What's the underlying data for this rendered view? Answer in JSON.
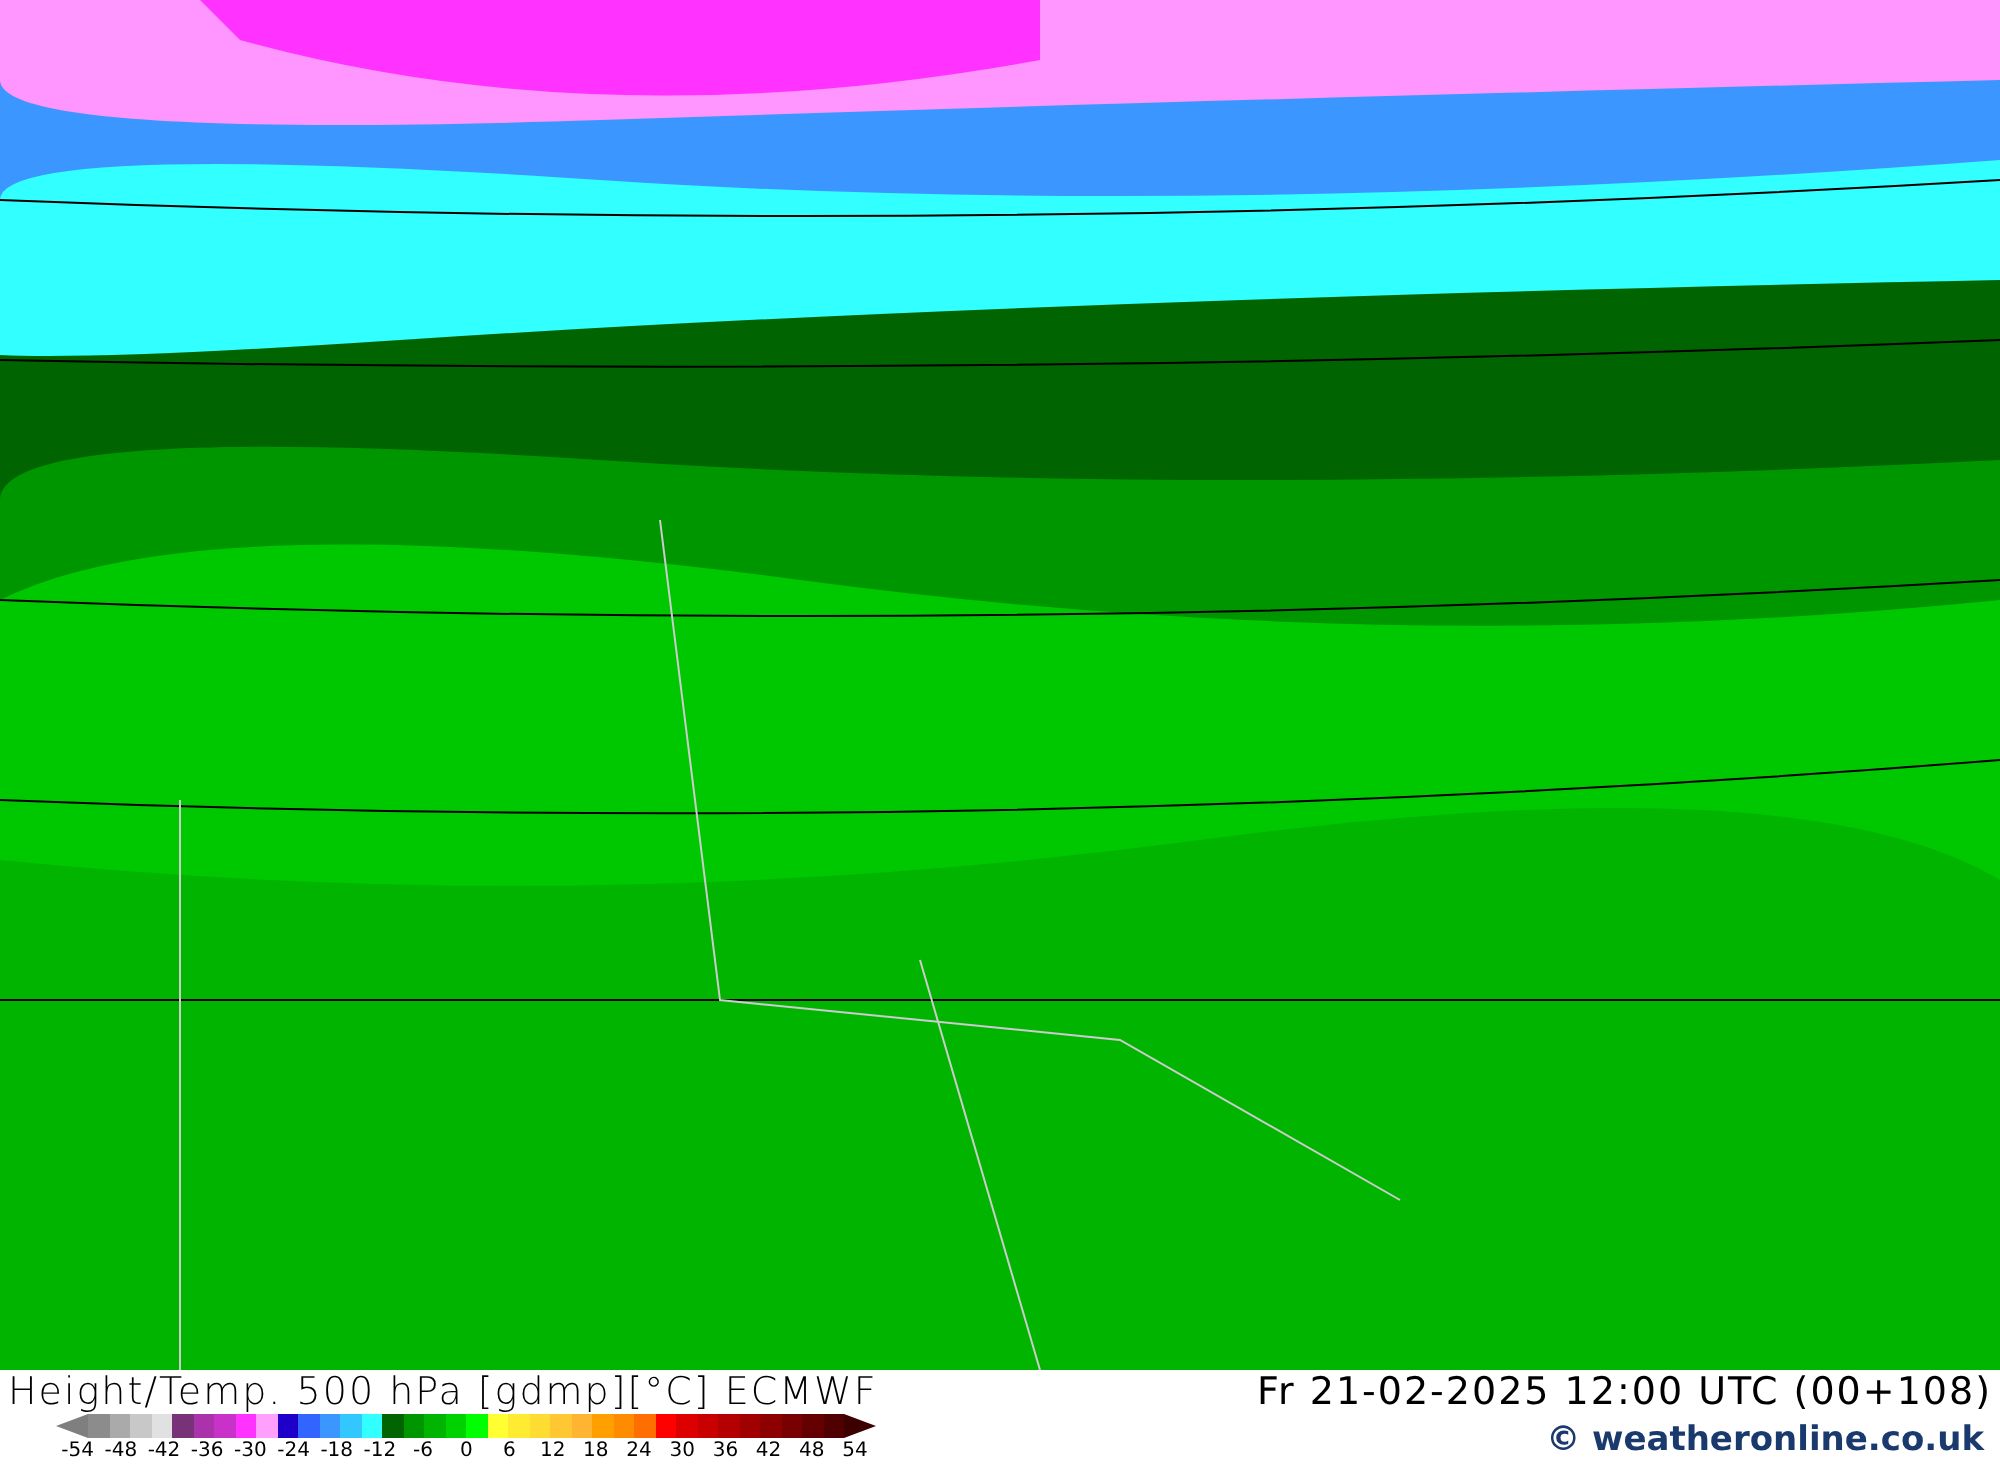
{
  "title": "Height/Temp. 500 hPa [gdmp][°C] ECMWF",
  "valid_time": "Fr 21-02-2025 12:00 UTC (00+108)",
  "legend": {
    "swatches": [
      {
        "color": "#7f7f7f"
      },
      {
        "color": "#8c8c8c"
      },
      {
        "color": "#aaaaaa"
      },
      {
        "color": "#c8c8c8"
      },
      {
        "color": "#e1e1e1"
      },
      {
        "color": "#783278"
      },
      {
        "color": "#aa32aa"
      },
      {
        "color": "#c832c8"
      },
      {
        "color": "#ff32ff"
      },
      {
        "color": "#ffa0ff"
      },
      {
        "color": "#1e00c8"
      },
      {
        "color": "#3264ff"
      },
      {
        "color": "#3c96ff"
      },
      {
        "color": "#32c8ff"
      },
      {
        "color": "#32ffff"
      },
      {
        "color": "#006400"
      },
      {
        "color": "#009600"
      },
      {
        "color": "#00b400"
      },
      {
        "color": "#00d200"
      },
      {
        "color": "#00ff00"
      },
      {
        "color": "#ffff32"
      },
      {
        "color": "#ffeb32"
      },
      {
        "color": "#ffdc32"
      },
      {
        "color": "#ffc832"
      },
      {
        "color": "#ffb432"
      },
      {
        "color": "#ffa000"
      },
      {
        "color": "#ff8c00"
      },
      {
        "color": "#ff6e00"
      },
      {
        "color": "#ff0000"
      },
      {
        "color": "#dc0000"
      },
      {
        "color": "#c80000"
      },
      {
        "color": "#b40000"
      },
      {
        "color": "#a00000"
      },
      {
        "color": "#8c0000"
      },
      {
        "color": "#780000"
      },
      {
        "color": "#640000"
      },
      {
        "color": "#500000"
      },
      {
        "color": "#3c0000"
      }
    ],
    "ticks": [
      "-54",
      "-48",
      "-42",
      "-36",
      "-30",
      "-24",
      "-18",
      "-12",
      "-6",
      "0",
      "6",
      "12",
      "18",
      "24",
      "30",
      "36",
      "42",
      "48",
      "54"
    ]
  },
  "credit": "© weatheronline.co.uk"
}
